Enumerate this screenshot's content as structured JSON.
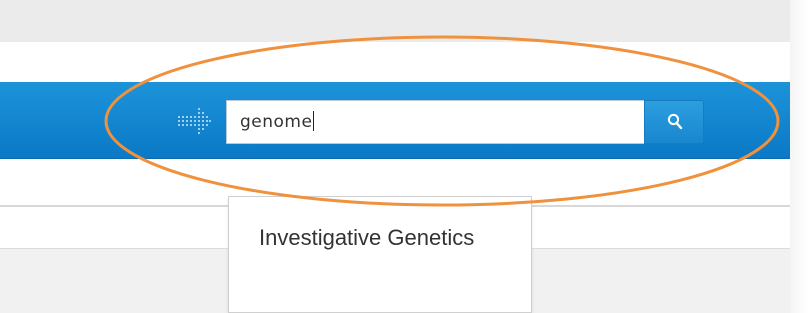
{
  "search": {
    "value": "genome",
    "button_icon": "search-icon",
    "nav_icon": "dotted-arrow-icon"
  },
  "suggestions": [
    {
      "label": "Investigative Genetics"
    }
  ],
  "colors": {
    "header_blue": "#0f80cc",
    "highlight_orange": "#f0913e",
    "top_strip": "#ebebeb"
  }
}
